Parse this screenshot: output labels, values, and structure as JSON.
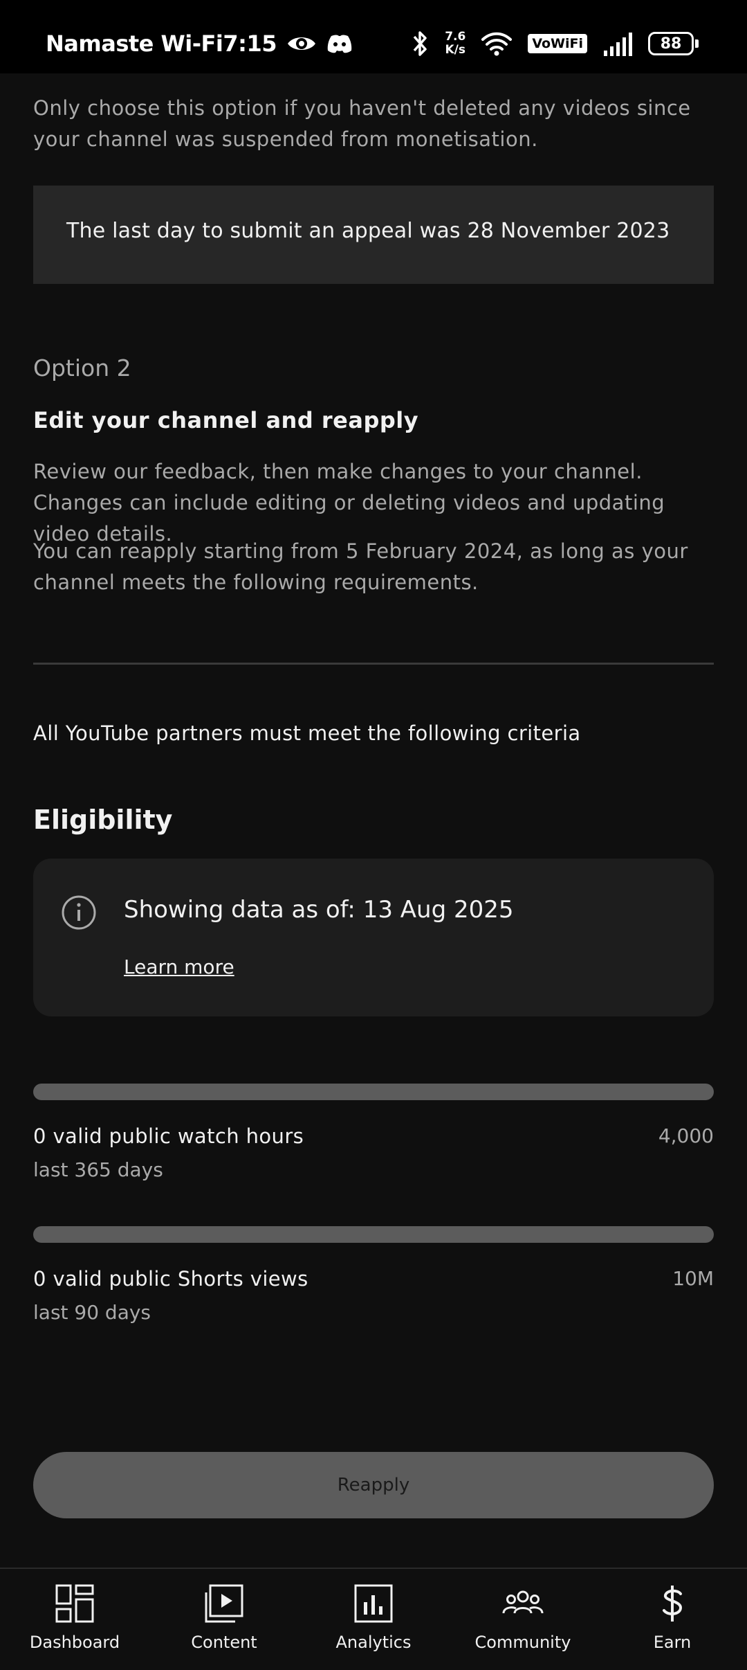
{
  "status_bar": {
    "carrier": "Namaste Wi-Fi",
    "time": "7:15",
    "net_speed_value": "7.6",
    "net_speed_unit": "K/s",
    "vowifi": "VoWiFi",
    "battery": "88",
    "icons": [
      "eye-icon",
      "discord-icon",
      "bluetooth-icon",
      "wifi-icon",
      "signal-icon",
      "battery-icon"
    ]
  },
  "content": {
    "paragraph_1": "Only choose this option if you haven't deleted any videos since your channel was suspended from monetisation.",
    "banner_text": "The last day to submit an appeal was 28 November 2023",
    "option_label": "Option 2",
    "option_title": "Edit your channel and reapply",
    "paragraph_2": "Review our feedback, then make changes to your channel. Changes can include editing or deleting videos and updating video details.",
    "paragraph_3": "You can reapply starting from 5 February 2024, as long as your channel meets the following requirements.",
    "criteria_text": "All YouTube partners must meet the following criteria",
    "eligibility_title": "Eligibility",
    "info_card": {
      "text": "Showing data as of: 13 Aug 2025",
      "link": "Learn more"
    },
    "metrics": [
      {
        "label": "0 valid public watch hours",
        "target": "4,000",
        "period": "last 365 days",
        "progress": 0
      },
      {
        "label": "0 valid public Shorts views",
        "target": "10M",
        "period": "last 90 days",
        "progress": 0
      }
    ],
    "reapply_button": "Reapply"
  },
  "bottom_nav": [
    {
      "label": "Dashboard",
      "icon": "dashboard-icon"
    },
    {
      "label": "Content",
      "icon": "content-icon"
    },
    {
      "label": "Analytics",
      "icon": "analytics-icon"
    },
    {
      "label": "Community",
      "icon": "community-icon"
    },
    {
      "label": "Earn",
      "icon": "earn-icon"
    }
  ],
  "colors": {
    "background": "#0f0f0f",
    "banner": "#272727",
    "card": "#1d1d1d",
    "progress_track": "#5c5c5c",
    "text_primary": "#f1f1f1",
    "text_secondary": "#aaaaaa"
  }
}
